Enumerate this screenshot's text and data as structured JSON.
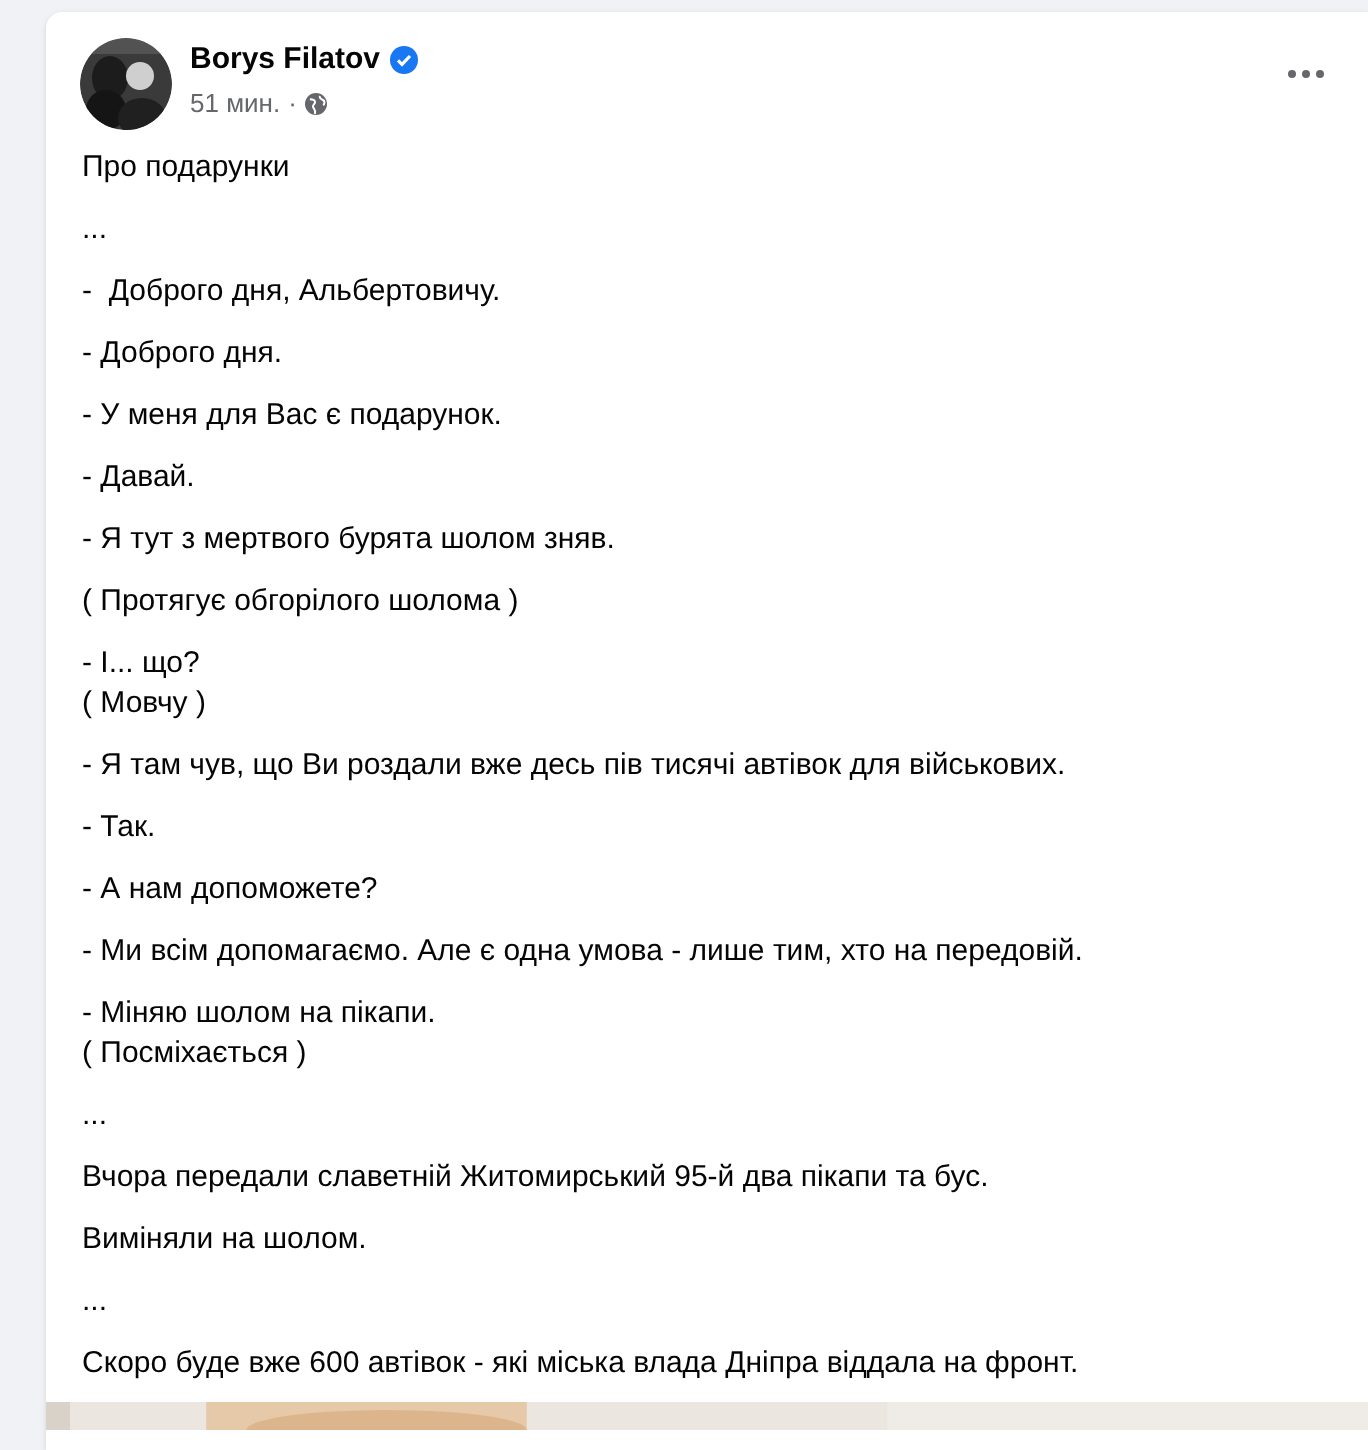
{
  "post": {
    "author": "Borys Filatov",
    "verified": true,
    "time": "51 мин.",
    "separator": "·",
    "paragraphs": [
      [
        "Про подарунки"
      ],
      [
        "..."
      ],
      [
        "-  Доброго дня, Альбертовичу."
      ],
      [
        "- Доброго дня."
      ],
      [
        "- У меня для Вас є подарунок."
      ],
      [
        "- Давай."
      ],
      [
        "- Я тут з мертвого бурята шолом зняв."
      ],
      [
        "( Протягує обгорілого шолома )"
      ],
      [
        "- І... що?",
        "( Мовчу )"
      ],
      [
        "- Я там чув, що Ви роздали вже десь пів тисячі автівок для військових."
      ],
      [
        "- Так."
      ],
      [
        "- А нам допоможете?"
      ],
      [
        "- Ми всім допомагаємо. Але є одна умова - лише тим, хто на передовій."
      ],
      [
        "- Міняю шолом на пікапи.",
        "( Посміхається )"
      ],
      [
        "..."
      ],
      [
        "Вчора передали славетній Житомирський 95-й два пікапи та бус."
      ],
      [
        "Виміняли на шолом."
      ],
      [
        "..."
      ],
      [
        "Скоро буде вже 600 автівок - які міська влада Дніпра віддала на фронт."
      ]
    ],
    "media": {
      "kind": "picture"
    }
  }
}
